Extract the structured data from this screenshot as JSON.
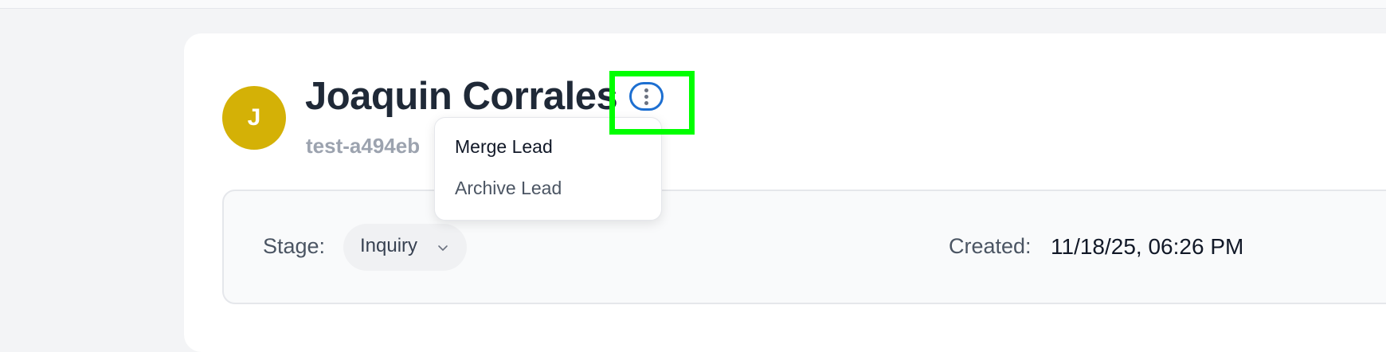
{
  "lead": {
    "avatar_initial": "J",
    "name": "Joaquin Corrales",
    "subtitle": "test-a494eb"
  },
  "more_menu": {
    "icon": "vertical-ellipsis-icon",
    "items": [
      {
        "label": "Merge Lead"
      },
      {
        "label": "Archive Lead"
      }
    ]
  },
  "details": {
    "stage_label": "Stage:",
    "stage_value": "Inquiry",
    "created_label": "Created:",
    "created_value": "11/18/25, 06:26 PM"
  },
  "colors": {
    "avatar_bg": "#d4b106",
    "focus_ring": "#1d6fd1",
    "highlight": "#00ff00"
  }
}
